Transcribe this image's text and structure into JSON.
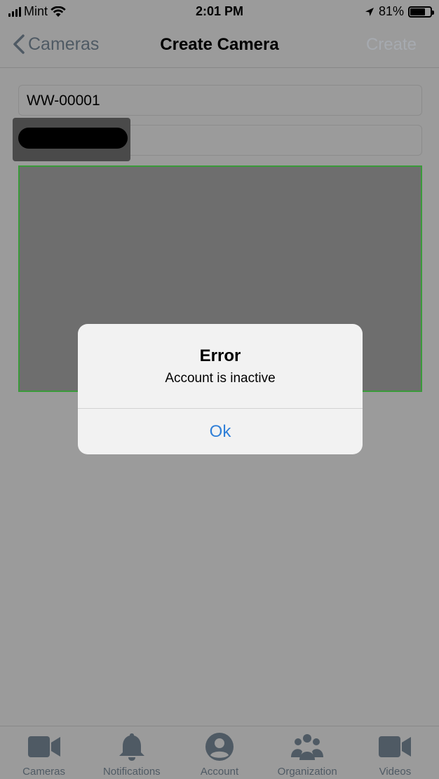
{
  "status": {
    "carrier": "Mint",
    "time": "2:01 PM",
    "battery": "81%",
    "battery_level": 0.81
  },
  "nav": {
    "back_label": "Cameras",
    "title": "Create Camera",
    "action_label": "Create"
  },
  "form": {
    "camera_name": "WW-00001",
    "camera_secret": ""
  },
  "alert": {
    "title": "Error",
    "message": "Account is inactive",
    "ok_label": "Ok"
  },
  "tabs": [
    {
      "label": "Cameras",
      "icon": "video-camera-icon"
    },
    {
      "label": "Notifications",
      "icon": "bell-icon"
    },
    {
      "label": "Account",
      "icon": "account-icon"
    },
    {
      "label": "Organization",
      "icon": "people-group-icon"
    },
    {
      "label": "Videos",
      "icon": "video-camera-icon"
    }
  ],
  "colors": {
    "accent": "#2f7fd8",
    "preview_border": "#3a9a3a",
    "icon_gray": "#4f5a64"
  }
}
